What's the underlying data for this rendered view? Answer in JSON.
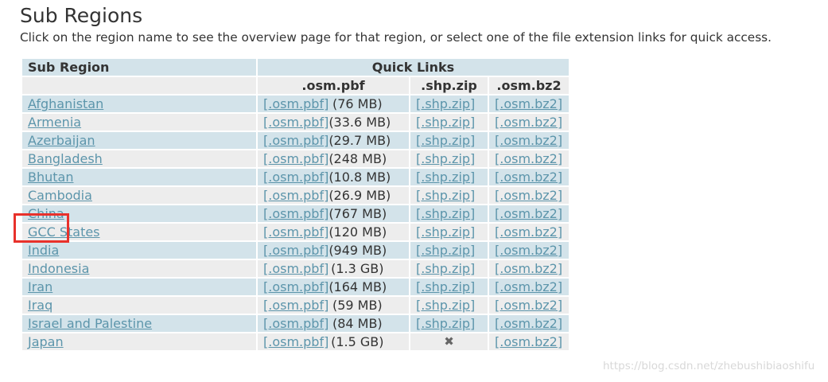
{
  "page": {
    "title": "Sub Regions",
    "subtitle": "Click on the region name to see the overview page for that region, or select one of the file extension links for quick access."
  },
  "table": {
    "header_region": "Sub Region",
    "header_quick": "Quick Links",
    "ext_pbf": ".osm.pbf",
    "ext_shp": ".shp.zip",
    "ext_bz2": ".osm.bz2",
    "pbf_link": "[.osm.pbf]",
    "shp_link": "[.shp.zip]",
    "bz2_link": "[.osm.bz2]",
    "missing_icon": "cross-icon",
    "missing_glyph": "✖",
    "rows": [
      {
        "name": "Afghanistan",
        "size": "(76 MB)",
        "shp": true
      },
      {
        "name": "Armenia",
        "size": "(33.6 MB)",
        "shp": true
      },
      {
        "name": "Azerbaijan",
        "size": "(29.7 MB)",
        "shp": true
      },
      {
        "name": "Bangladesh",
        "size": "(248 MB)",
        "shp": true
      },
      {
        "name": "Bhutan",
        "size": "(10.8 MB)",
        "shp": true
      },
      {
        "name": "Cambodia",
        "size": "(26.9 MB)",
        "shp": true
      },
      {
        "name": "China",
        "size": "(767 MB)",
        "shp": true
      },
      {
        "name": "GCC States",
        "size": "(120 MB)",
        "shp": true
      },
      {
        "name": "India",
        "size": "(949 MB)",
        "shp": true
      },
      {
        "name": "Indonesia",
        "size": "(1.3 GB)",
        "shp": true
      },
      {
        "name": "Iran",
        "size": "(164 MB)",
        "shp": true
      },
      {
        "name": "Iraq",
        "size": "(59 MB)",
        "shp": true
      },
      {
        "name": "Israel and Palestine",
        "size": "(84 MB)",
        "shp": true
      },
      {
        "name": "Japan",
        "size": "(1.5 GB)",
        "shp": false
      }
    ]
  },
  "highlight_color": "#e8312b",
  "watermark": "https://blog.csdn.net/zhebushibiaoshifu"
}
